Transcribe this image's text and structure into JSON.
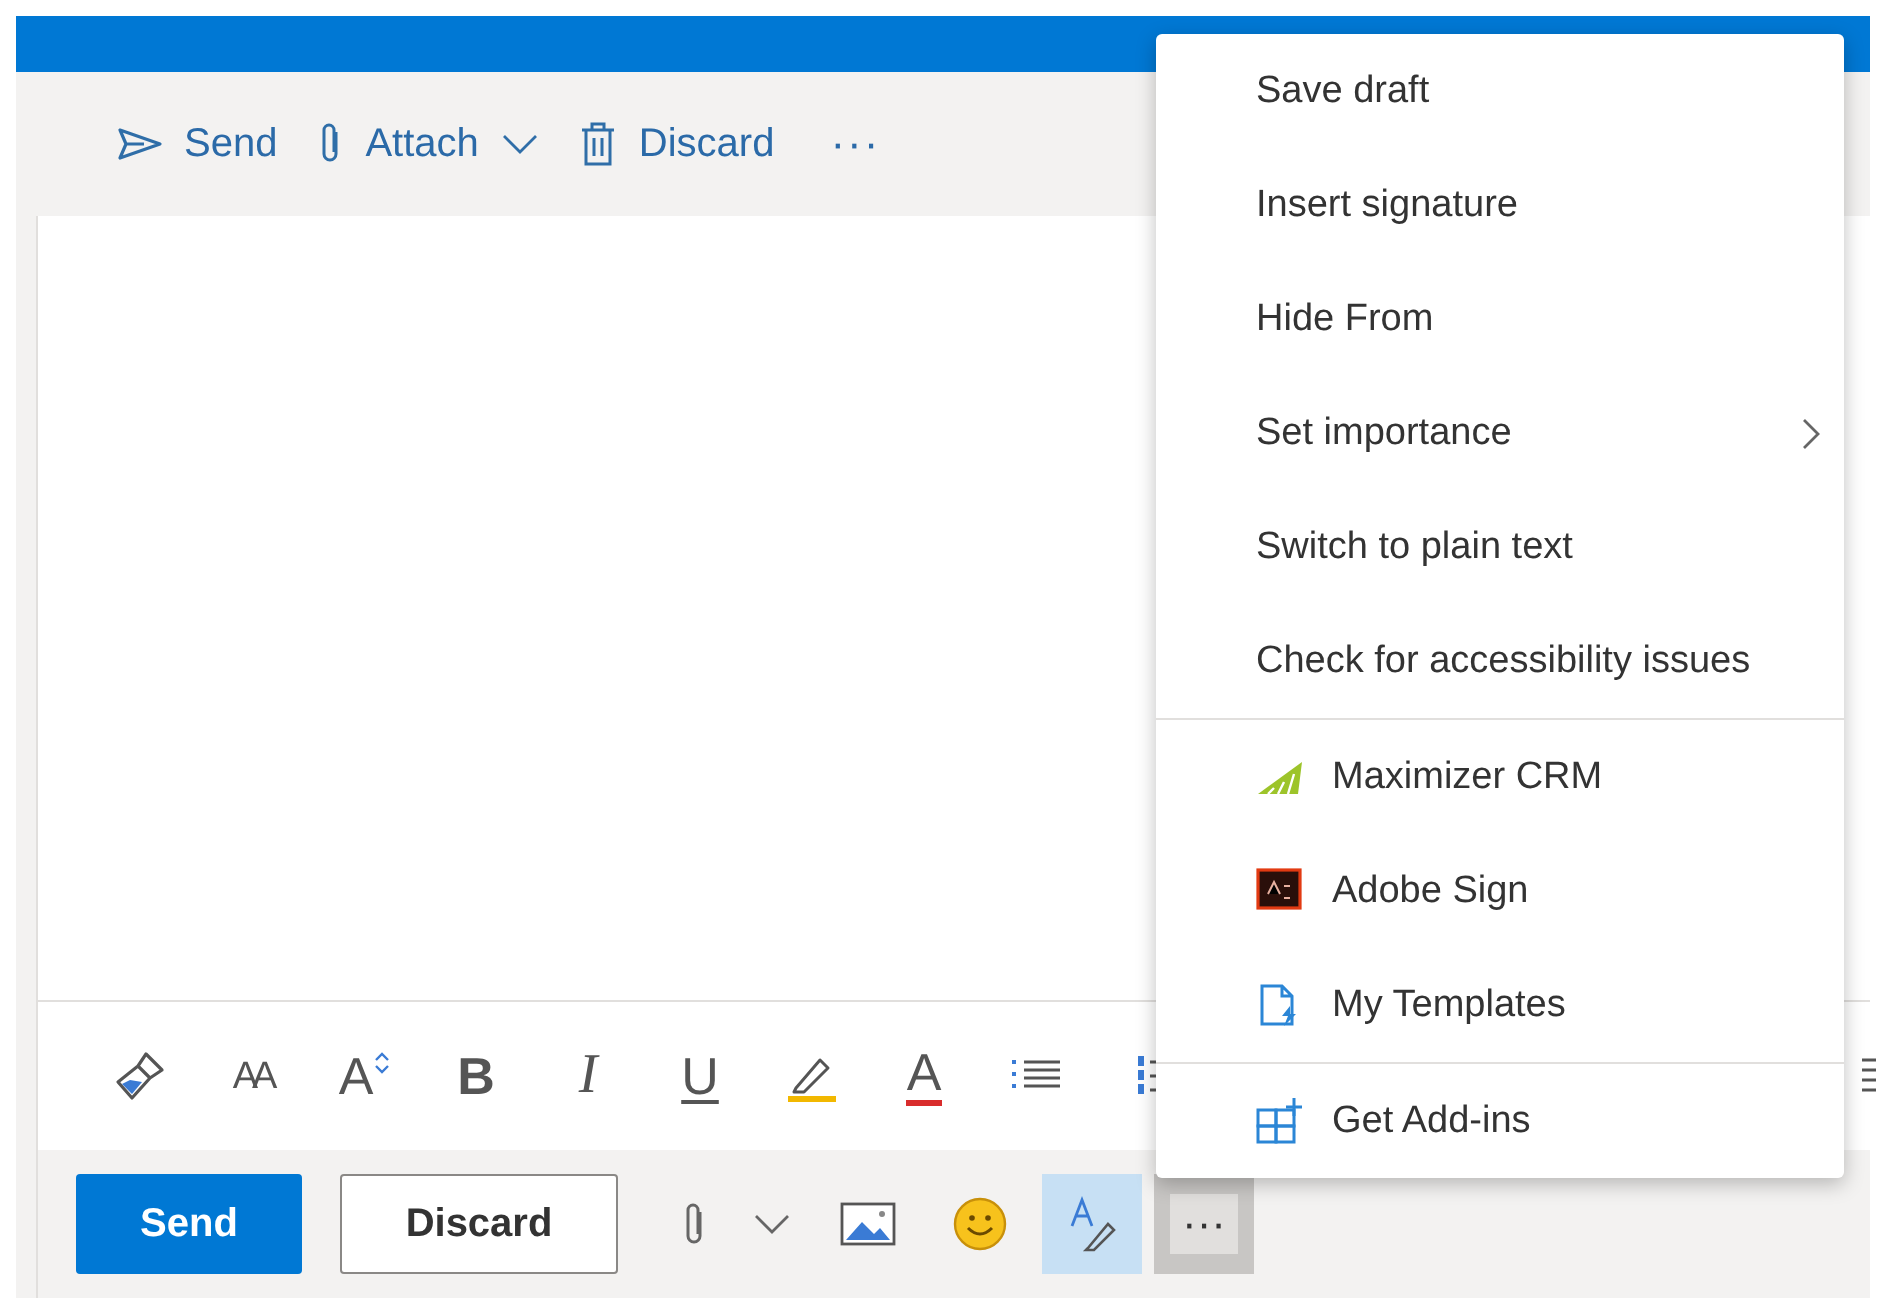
{
  "top_toolbar": [
    {
      "kind": "send",
      "label": "Send"
    },
    {
      "kind": "attach",
      "label": "Attach",
      "dropdown": true
    },
    {
      "kind": "discard",
      "label": "Discard"
    },
    {
      "kind": "more",
      "label": "···"
    }
  ],
  "format_toolbar": [
    {
      "kind": "painter"
    },
    {
      "kind": "size",
      "glyph": "AA"
    },
    {
      "kind": "grow",
      "glyph": "A"
    },
    {
      "kind": "bold",
      "glyph": "B"
    },
    {
      "kind": "italic",
      "glyph": "I"
    },
    {
      "kind": "underline",
      "glyph": "U"
    },
    {
      "kind": "highlight"
    },
    {
      "kind": "fontcolor",
      "glyph": "A"
    },
    {
      "kind": "bullets"
    },
    {
      "kind": "numbers"
    }
  ],
  "bottom_bar": {
    "send": "Send",
    "discard": "Discard",
    "tools": [
      {
        "kind": "attach"
      },
      {
        "kind": "dropdown"
      },
      {
        "kind": "image"
      },
      {
        "kind": "emoji"
      },
      {
        "kind": "editor",
        "on": true
      },
      {
        "kind": "more",
        "label": "···",
        "expanded": true
      }
    ]
  },
  "menu": [
    [
      {
        "kind": "plain",
        "label": "Save draft"
      },
      {
        "kind": "plain",
        "label": "Insert signature"
      },
      {
        "kind": "plain",
        "label": "Hide From"
      },
      {
        "kind": "plain",
        "label": "Set importance",
        "submenu": true
      },
      {
        "kind": "plain",
        "label": "Switch to plain text"
      },
      {
        "kind": "plain",
        "label": "Check for accessibility issues"
      }
    ],
    [
      {
        "kind": "crm",
        "label": "Maximizer CRM"
      },
      {
        "kind": "adobe",
        "label": "Adobe Sign"
      },
      {
        "kind": "templates",
        "label": "My Templates"
      }
    ],
    [
      {
        "kind": "addins",
        "label": "Get Add-ins"
      }
    ]
  ]
}
